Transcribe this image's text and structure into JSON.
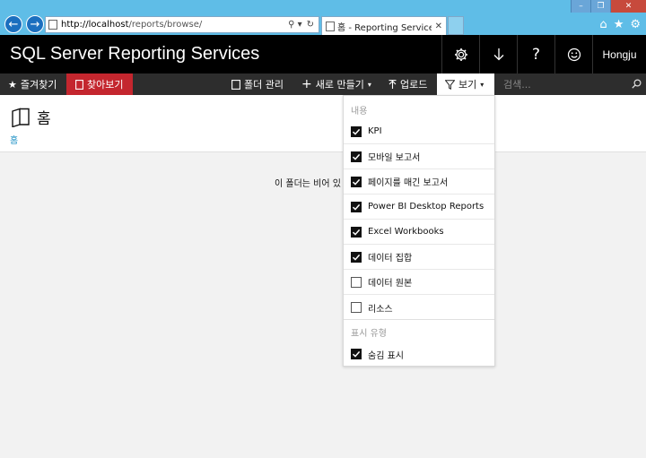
{
  "browser": {
    "url_host": "http://localhost",
    "url_path": "/reports/browse/",
    "tab_title": "홈 - Reporting Services 웹 ...",
    "addr_tools": [
      "⚲ ▾",
      "↻"
    ]
  },
  "app": {
    "title": "SQL Server Reporting Services",
    "user": "Hongju"
  },
  "toolbar": {
    "favorites": "즐겨찾기",
    "browse": "찾아보기",
    "manage_folder": "폴더 관리",
    "new": "새로 만들기",
    "upload": "업로드",
    "view": "보기",
    "search_placeholder": "검색..."
  },
  "page": {
    "title": "홈",
    "breadcrumb": "홈",
    "empty_message": "이 폴더는 비어 있"
  },
  "view_menu": {
    "content_header": "내용",
    "content_items": [
      {
        "label": "KPI",
        "checked": true
      },
      {
        "label": "모바일 보고서",
        "checked": true
      },
      {
        "label": "페이지를 매긴 보고서",
        "checked": true
      },
      {
        "label": "Power BI Desktop Reports",
        "checked": true
      },
      {
        "label": "Excel Workbooks",
        "checked": true
      },
      {
        "label": "데이터 집합",
        "checked": true
      },
      {
        "label": "데이터 원본",
        "checked": false
      },
      {
        "label": "리소스",
        "checked": false
      }
    ],
    "display_header": "표시 유형",
    "display_items": [
      {
        "label": "숨김 표시",
        "checked": true
      }
    ]
  },
  "colors": {
    "header_bg": "#000000",
    "toolbar_bg": "#2d2d2d",
    "browse_active": "#c4262e",
    "link": "#1b8fc4",
    "chrome": "#5fbde7"
  },
  "icons": [
    "back-icon",
    "forward-icon",
    "settings-icon",
    "download-icon",
    "help-icon",
    "smiley-icon",
    "star-icon",
    "bookmark-icon",
    "folder-icon",
    "plus-icon",
    "upload-icon",
    "filter-icon",
    "chevron-down-icon",
    "search-icon",
    "home-icon",
    "gear-icon"
  ]
}
